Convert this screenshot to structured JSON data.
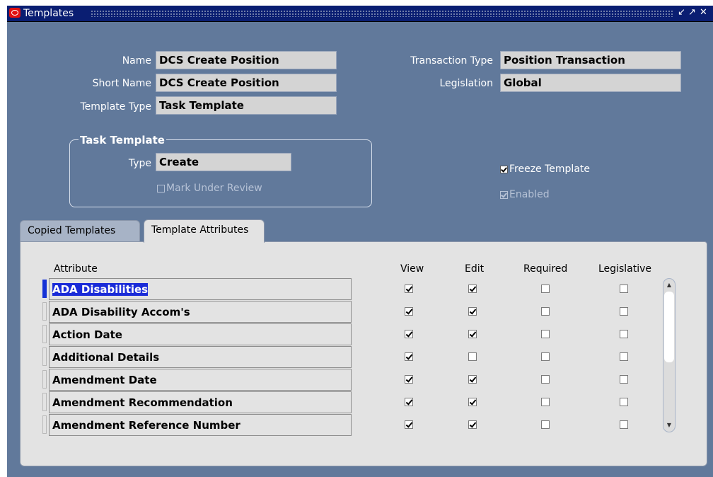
{
  "window": {
    "title": "Templates",
    "controls": [
      "minimize",
      "maximize",
      "close"
    ]
  },
  "header": {
    "name_label": "Name",
    "name_value": "DCS Create Position",
    "short_name_label": "Short Name",
    "short_name_value": "DCS Create Position",
    "template_type_label": "Template Type",
    "template_type_value": "Task Template",
    "transaction_type_label": "Transaction Type",
    "transaction_type_value": "Position Transaction",
    "legislation_label": "Legislation",
    "legislation_value": "Global"
  },
  "task_template": {
    "group_title": "Task Template",
    "type_label": "Type",
    "type_value": "Create",
    "mark_under_review_label": "Mark Under Review",
    "mark_under_review_checked": false
  },
  "options": {
    "freeze_template_label": "Freeze Template",
    "freeze_template_checked": true,
    "enabled_label": "Enabled",
    "enabled_checked": true
  },
  "tabs": [
    {
      "label": "Copied Templates",
      "active": false
    },
    {
      "label": "Template Attributes",
      "active": true
    }
  ],
  "table": {
    "columns": [
      "Attribute",
      "View",
      "Edit",
      "Required",
      "Legislative"
    ],
    "rows": [
      {
        "attribute": "ADA Disabilities",
        "view": true,
        "edit": true,
        "required": false,
        "legislative": false,
        "selected": true
      },
      {
        "attribute": "ADA Disability Accom's",
        "view": true,
        "edit": true,
        "required": false,
        "legislative": false,
        "selected": false
      },
      {
        "attribute": "Action Date",
        "view": true,
        "edit": true,
        "required": false,
        "legislative": false,
        "selected": false
      },
      {
        "attribute": "Additional Details",
        "view": true,
        "edit": false,
        "required": false,
        "legislative": false,
        "selected": false
      },
      {
        "attribute": "Amendment Date",
        "view": true,
        "edit": true,
        "required": false,
        "legislative": false,
        "selected": false
      },
      {
        "attribute": "Amendment Recommendation",
        "view": true,
        "edit": true,
        "required": false,
        "legislative": false,
        "selected": false
      },
      {
        "attribute": "Amendment Reference Number",
        "view": true,
        "edit": true,
        "required": false,
        "legislative": false,
        "selected": false
      }
    ]
  },
  "colors": {
    "window_bg": "#61799b",
    "titlebar_bg": "#0a1e72",
    "selection": "#1a2bd8",
    "panel_bg": "#e3e3e3"
  }
}
